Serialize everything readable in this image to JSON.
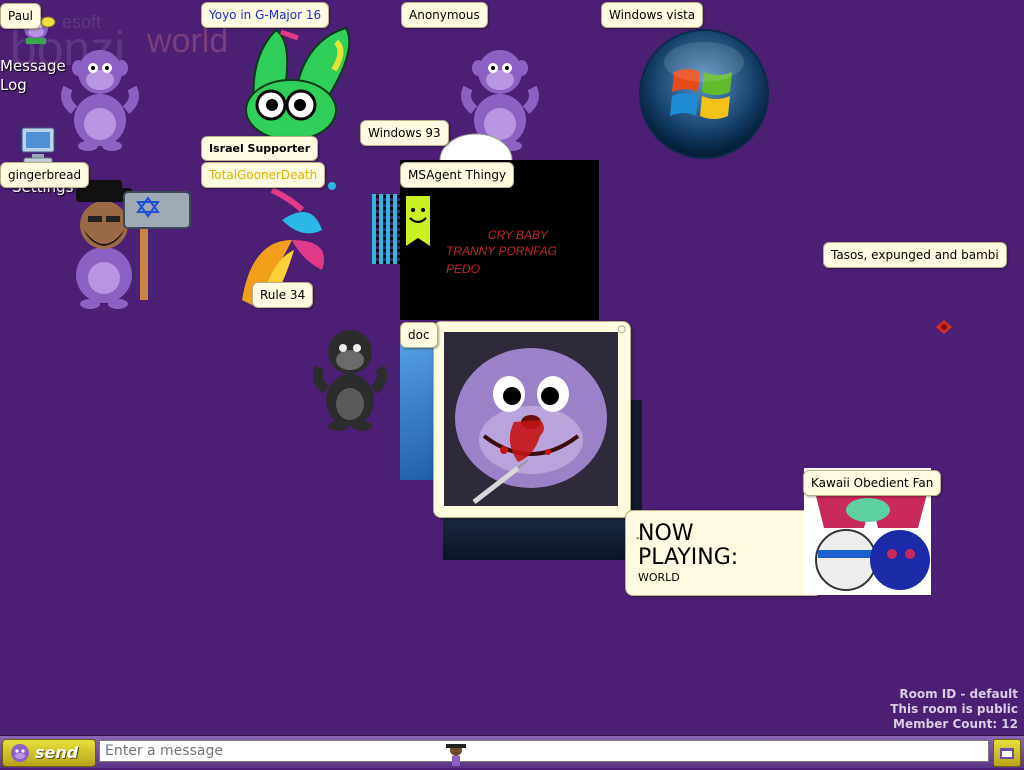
{
  "app": {
    "logo_small": "bonzi",
    "logo_brand": "esoft",
    "logo_world": "world"
  },
  "sidebar": {
    "message_log_label": "Message Log",
    "settings_label": "Settings"
  },
  "users": [
    {
      "name": "Paul",
      "color": "#000000"
    },
    {
      "name": "Yoyo in G-Major 16",
      "color": "#1a2bd4"
    },
    {
      "name": "Anonymous",
      "color": "#000000"
    },
    {
      "name": "Windows vista",
      "color": "#000000"
    },
    {
      "name": "Windows 93",
      "color": "#000000"
    },
    {
      "name": "Israel Supporter",
      "color": "#000000"
    },
    {
      "name": "TotalGoonerDeath",
      "color": "#e0b400"
    },
    {
      "name": "gingerbread",
      "color": "#000000"
    },
    {
      "name": "MSAgent Thingy",
      "color": "#000000"
    },
    {
      "name": "Rule 34",
      "color": "#000000"
    },
    {
      "name": "Tasos, expunged and bambi",
      "color": "#000000"
    },
    {
      "name": "Kawaii Obedient Fan",
      "color": "#000000"
    },
    {
      "name": "doc",
      "color": "#000000"
    }
  ],
  "overlay_text": {
    "line1": "CRY BABY",
    "line2": "TRANNY PORNFAG",
    "line3": "PEDO"
  },
  "now_playing": {
    "prefix": "-",
    "title": "NOW PLAYING:",
    "song": "WORLD"
  },
  "room": {
    "id_label": "Room ID - default",
    "public_label": "This room is public",
    "member_count_label": "Member Count: 12"
  },
  "chat": {
    "send_label": "send",
    "input_placeholder": "Enter a message"
  },
  "colors": {
    "background": "#4b1f73",
    "bonzi_purple": "#8b62c4",
    "tag_bg": "#fffbe0"
  }
}
